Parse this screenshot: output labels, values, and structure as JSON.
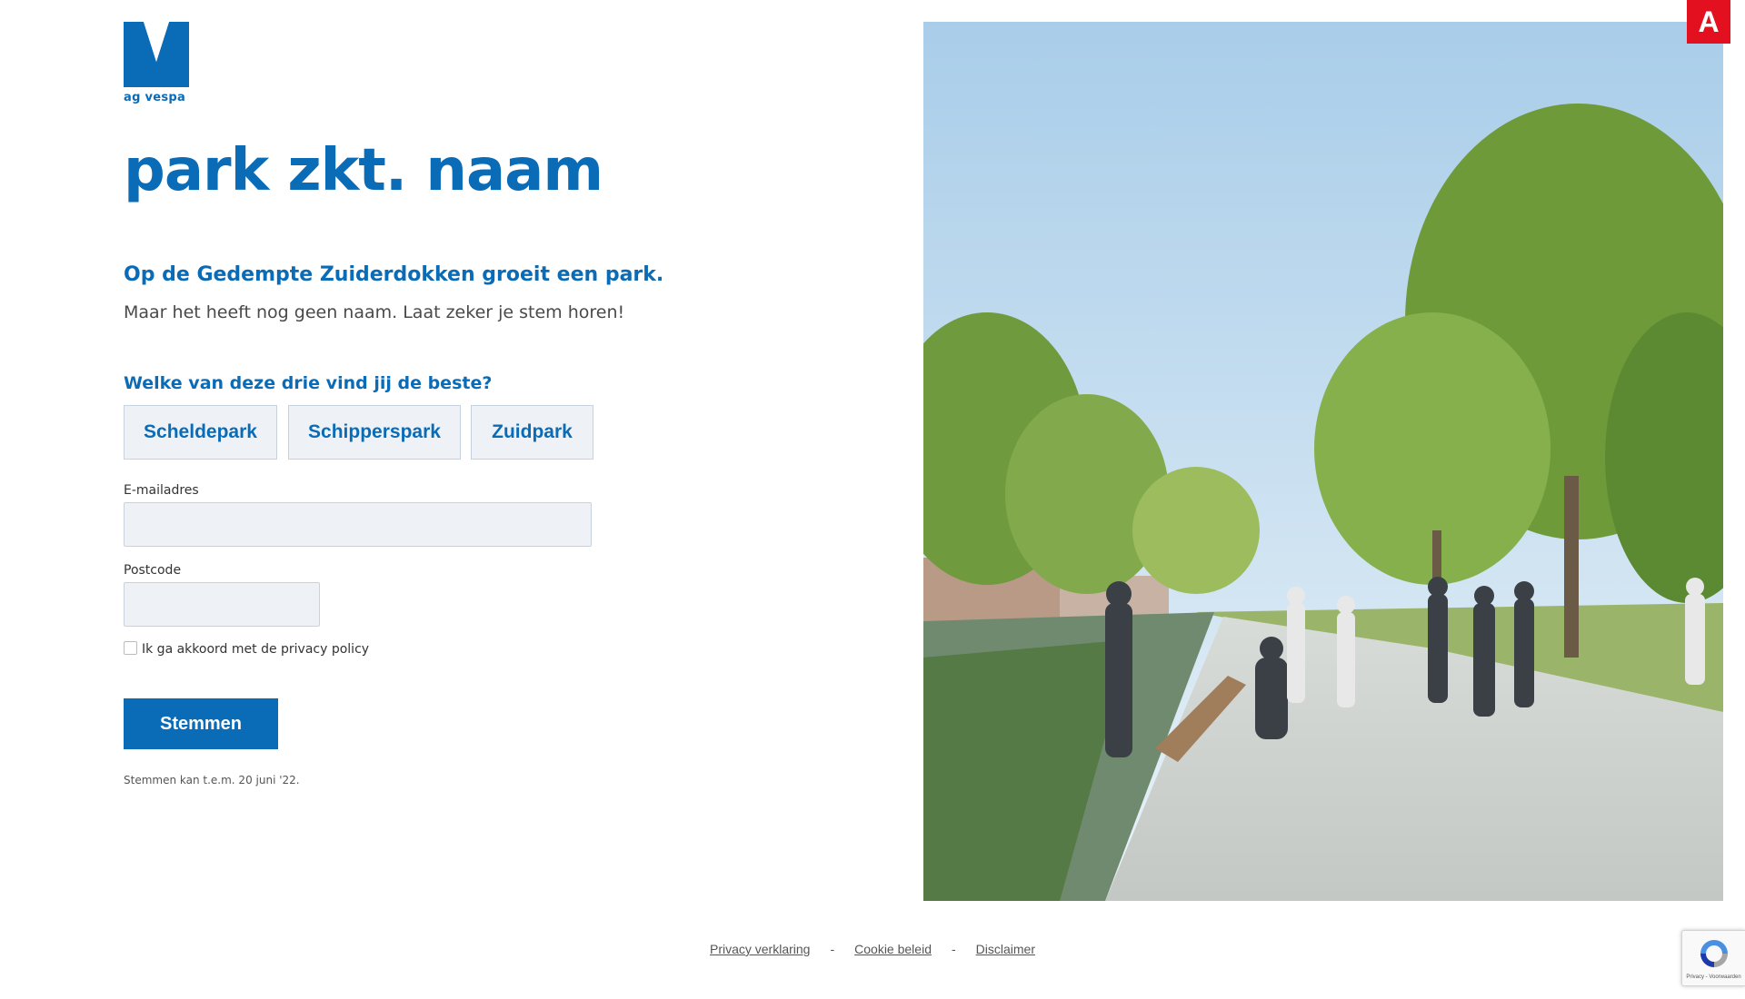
{
  "brand": {
    "logo_text": "ag vespa",
    "accent_color": "#0a6bb7",
    "city_badge": "A",
    "city_badge_color": "#e3111f"
  },
  "page": {
    "title": "park zkt. naam",
    "subtitle": "Op de Gedempte Zuiderdokken groeit een park.",
    "intro": "Maar het heeft nog geen naam. Laat zeker je stem horen!"
  },
  "form": {
    "question": "Welke van deze drie vind jij de beste?",
    "choices": [
      "Scheldepark",
      "Schipperspark",
      "Zuidpark"
    ],
    "email_label": "E-mailadres",
    "email_value": "",
    "postcode_label": "Postcode",
    "postcode_value": "",
    "privacy_label": "Ik ga akkoord met de privacy policy",
    "privacy_checked": false,
    "submit_label": "Stemmen",
    "deadline_note": "Stemmen kan t.e.m. 20 juni '22."
  },
  "footer": {
    "links": [
      "Privacy verklaring",
      "Cookie beleid",
      "Disclaimer"
    ],
    "separator": "-"
  },
  "recaptcha": {
    "text": "Privacy - Voorwaarden"
  }
}
